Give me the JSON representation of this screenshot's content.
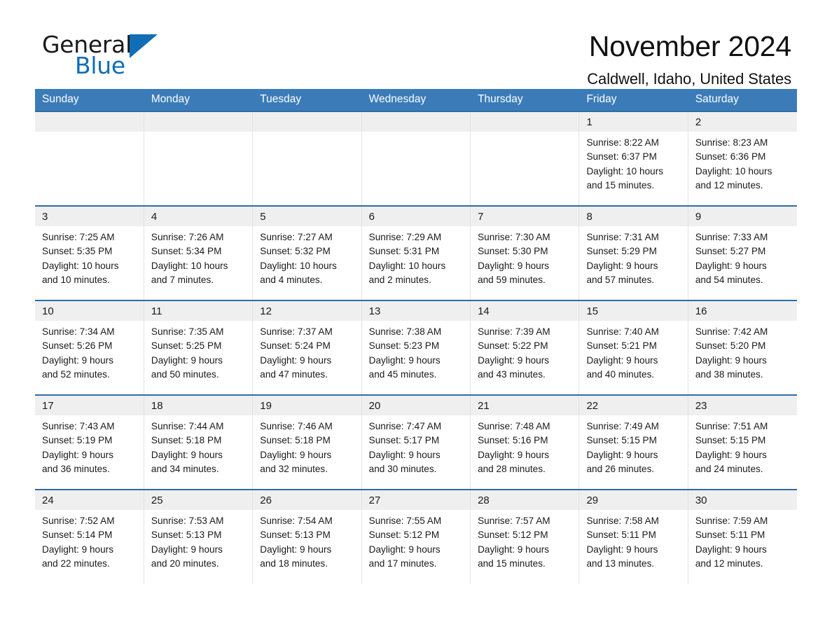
{
  "brand": {
    "name_part1": "General",
    "name_part2": "Blue",
    "mark": "triangle-logo",
    "colors": {
      "black": "#1a1a1a",
      "blue": "#0f6eb5"
    }
  },
  "header": {
    "title": "November 2024",
    "subtitle": "Caldwell, Idaho, United States"
  },
  "theme": {
    "header_bg": "#3b7cb8",
    "header_text": "#ffffff",
    "row_divider": "#2e6da4",
    "date_band_bg": "#efefef",
    "cell_bg": "#ffffff"
  },
  "weekday_headers": [
    {
      "label": "Sunday"
    },
    {
      "label": "Monday"
    },
    {
      "label": "Tuesday"
    },
    {
      "label": "Wednesday"
    },
    {
      "label": "Thursday"
    },
    {
      "label": "Friday"
    },
    {
      "label": "Saturday"
    }
  ],
  "weeks": [
    [
      {
        "empty": true,
        "date": "",
        "sunrise": "",
        "sunset": "",
        "daylight_line1": "",
        "daylight_line2": ""
      },
      {
        "empty": true,
        "date": "",
        "sunrise": "",
        "sunset": "",
        "daylight_line1": "",
        "daylight_line2": ""
      },
      {
        "empty": true,
        "date": "",
        "sunrise": "",
        "sunset": "",
        "daylight_line1": "",
        "daylight_line2": ""
      },
      {
        "empty": true,
        "date": "",
        "sunrise": "",
        "sunset": "",
        "daylight_line1": "",
        "daylight_line2": ""
      },
      {
        "empty": true,
        "date": "",
        "sunrise": "",
        "sunset": "",
        "daylight_line1": "",
        "daylight_line2": ""
      },
      {
        "empty": false,
        "date": "1",
        "sunrise": "Sunrise: 8:22 AM",
        "sunset": "Sunset: 6:37 PM",
        "daylight_line1": "Daylight: 10 hours",
        "daylight_line2": "and 15 minutes."
      },
      {
        "empty": false,
        "date": "2",
        "sunrise": "Sunrise: 8:23 AM",
        "sunset": "Sunset: 6:36 PM",
        "daylight_line1": "Daylight: 10 hours",
        "daylight_line2": "and 12 minutes."
      }
    ],
    [
      {
        "empty": false,
        "date": "3",
        "sunrise": "Sunrise: 7:25 AM",
        "sunset": "Sunset: 5:35 PM",
        "daylight_line1": "Daylight: 10 hours",
        "daylight_line2": "and 10 minutes."
      },
      {
        "empty": false,
        "date": "4",
        "sunrise": "Sunrise: 7:26 AM",
        "sunset": "Sunset: 5:34 PM",
        "daylight_line1": "Daylight: 10 hours",
        "daylight_line2": "and 7 minutes."
      },
      {
        "empty": false,
        "date": "5",
        "sunrise": "Sunrise: 7:27 AM",
        "sunset": "Sunset: 5:32 PM",
        "daylight_line1": "Daylight: 10 hours",
        "daylight_line2": "and 4 minutes."
      },
      {
        "empty": false,
        "date": "6",
        "sunrise": "Sunrise: 7:29 AM",
        "sunset": "Sunset: 5:31 PM",
        "daylight_line1": "Daylight: 10 hours",
        "daylight_line2": "and 2 minutes."
      },
      {
        "empty": false,
        "date": "7",
        "sunrise": "Sunrise: 7:30 AM",
        "sunset": "Sunset: 5:30 PM",
        "daylight_line1": "Daylight: 9 hours",
        "daylight_line2": "and 59 minutes."
      },
      {
        "empty": false,
        "date": "8",
        "sunrise": "Sunrise: 7:31 AM",
        "sunset": "Sunset: 5:29 PM",
        "daylight_line1": "Daylight: 9 hours",
        "daylight_line2": "and 57 minutes."
      },
      {
        "empty": false,
        "date": "9",
        "sunrise": "Sunrise: 7:33 AM",
        "sunset": "Sunset: 5:27 PM",
        "daylight_line1": "Daylight: 9 hours",
        "daylight_line2": "and 54 minutes."
      }
    ],
    [
      {
        "empty": false,
        "date": "10",
        "sunrise": "Sunrise: 7:34 AM",
        "sunset": "Sunset: 5:26 PM",
        "daylight_line1": "Daylight: 9 hours",
        "daylight_line2": "and 52 minutes."
      },
      {
        "empty": false,
        "date": "11",
        "sunrise": "Sunrise: 7:35 AM",
        "sunset": "Sunset: 5:25 PM",
        "daylight_line1": "Daylight: 9 hours",
        "daylight_line2": "and 50 minutes."
      },
      {
        "empty": false,
        "date": "12",
        "sunrise": "Sunrise: 7:37 AM",
        "sunset": "Sunset: 5:24 PM",
        "daylight_line1": "Daylight: 9 hours",
        "daylight_line2": "and 47 minutes."
      },
      {
        "empty": false,
        "date": "13",
        "sunrise": "Sunrise: 7:38 AM",
        "sunset": "Sunset: 5:23 PM",
        "daylight_line1": "Daylight: 9 hours",
        "daylight_line2": "and 45 minutes."
      },
      {
        "empty": false,
        "date": "14",
        "sunrise": "Sunrise: 7:39 AM",
        "sunset": "Sunset: 5:22 PM",
        "daylight_line1": "Daylight: 9 hours",
        "daylight_line2": "and 43 minutes."
      },
      {
        "empty": false,
        "date": "15",
        "sunrise": "Sunrise: 7:40 AM",
        "sunset": "Sunset: 5:21 PM",
        "daylight_line1": "Daylight: 9 hours",
        "daylight_line2": "and 40 minutes."
      },
      {
        "empty": false,
        "date": "16",
        "sunrise": "Sunrise: 7:42 AM",
        "sunset": "Sunset: 5:20 PM",
        "daylight_line1": "Daylight: 9 hours",
        "daylight_line2": "and 38 minutes."
      }
    ],
    [
      {
        "empty": false,
        "date": "17",
        "sunrise": "Sunrise: 7:43 AM",
        "sunset": "Sunset: 5:19 PM",
        "daylight_line1": "Daylight: 9 hours",
        "daylight_line2": "and 36 minutes."
      },
      {
        "empty": false,
        "date": "18",
        "sunrise": "Sunrise: 7:44 AM",
        "sunset": "Sunset: 5:18 PM",
        "daylight_line1": "Daylight: 9 hours",
        "daylight_line2": "and 34 minutes."
      },
      {
        "empty": false,
        "date": "19",
        "sunrise": "Sunrise: 7:46 AM",
        "sunset": "Sunset: 5:18 PM",
        "daylight_line1": "Daylight: 9 hours",
        "daylight_line2": "and 32 minutes."
      },
      {
        "empty": false,
        "date": "20",
        "sunrise": "Sunrise: 7:47 AM",
        "sunset": "Sunset: 5:17 PM",
        "daylight_line1": "Daylight: 9 hours",
        "daylight_line2": "and 30 minutes."
      },
      {
        "empty": false,
        "date": "21",
        "sunrise": "Sunrise: 7:48 AM",
        "sunset": "Sunset: 5:16 PM",
        "daylight_line1": "Daylight: 9 hours",
        "daylight_line2": "and 28 minutes."
      },
      {
        "empty": false,
        "date": "22",
        "sunrise": "Sunrise: 7:49 AM",
        "sunset": "Sunset: 5:15 PM",
        "daylight_line1": "Daylight: 9 hours",
        "daylight_line2": "and 26 minutes."
      },
      {
        "empty": false,
        "date": "23",
        "sunrise": "Sunrise: 7:51 AM",
        "sunset": "Sunset: 5:15 PM",
        "daylight_line1": "Daylight: 9 hours",
        "daylight_line2": "and 24 minutes."
      }
    ],
    [
      {
        "empty": false,
        "date": "24",
        "sunrise": "Sunrise: 7:52 AM",
        "sunset": "Sunset: 5:14 PM",
        "daylight_line1": "Daylight: 9 hours",
        "daylight_line2": "and 22 minutes."
      },
      {
        "empty": false,
        "date": "25",
        "sunrise": "Sunrise: 7:53 AM",
        "sunset": "Sunset: 5:13 PM",
        "daylight_line1": "Daylight: 9 hours",
        "daylight_line2": "and 20 minutes."
      },
      {
        "empty": false,
        "date": "26",
        "sunrise": "Sunrise: 7:54 AM",
        "sunset": "Sunset: 5:13 PM",
        "daylight_line1": "Daylight: 9 hours",
        "daylight_line2": "and 18 minutes."
      },
      {
        "empty": false,
        "date": "27",
        "sunrise": "Sunrise: 7:55 AM",
        "sunset": "Sunset: 5:12 PM",
        "daylight_line1": "Daylight: 9 hours",
        "daylight_line2": "and 17 minutes."
      },
      {
        "empty": false,
        "date": "28",
        "sunrise": "Sunrise: 7:57 AM",
        "sunset": "Sunset: 5:12 PM",
        "daylight_line1": "Daylight: 9 hours",
        "daylight_line2": "and 15 minutes."
      },
      {
        "empty": false,
        "date": "29",
        "sunrise": "Sunrise: 7:58 AM",
        "sunset": "Sunset: 5:11 PM",
        "daylight_line1": "Daylight: 9 hours",
        "daylight_line2": "and 13 minutes."
      },
      {
        "empty": false,
        "date": "30",
        "sunrise": "Sunrise: 7:59 AM",
        "sunset": "Sunset: 5:11 PM",
        "daylight_line1": "Daylight: 9 hours",
        "daylight_line2": "and 12 minutes."
      }
    ]
  ]
}
